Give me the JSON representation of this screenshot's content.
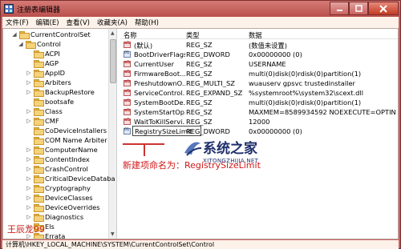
{
  "window": {
    "title": "注册表编辑器",
    "app_icon": "regedit-icon",
    "controls": {
      "minimize": "minimize-icon",
      "maximize": "maximize-icon",
      "close": "close-icon"
    }
  },
  "menu": [
    "文件(F)",
    "编辑(E)",
    "查看(V)",
    "收藏夹(A)",
    "帮助(H)"
  ],
  "tree": {
    "items": [
      {
        "label": "CurrentControlSet",
        "toggle": "◢",
        "level": 0
      },
      {
        "label": "Control",
        "toggle": "◢",
        "level": 1
      },
      {
        "label": "ACPI",
        "toggle": "",
        "level": 2
      },
      {
        "label": "AGP",
        "toggle": "",
        "level": 2
      },
      {
        "label": "AppID",
        "toggle": "▷",
        "level": 2
      },
      {
        "label": "Arbiters",
        "toggle": "▷",
        "level": 2
      },
      {
        "label": "BackupRestore",
        "toggle": "▷",
        "level": 2
      },
      {
        "label": "bootsafe",
        "toggle": "",
        "level": 2
      },
      {
        "label": "Class",
        "toggle": "▷",
        "level": 2
      },
      {
        "label": "CMF",
        "toggle": "▷",
        "level": 2
      },
      {
        "label": "CoDeviceInstallers",
        "toggle": "",
        "level": 2
      },
      {
        "label": "COM Name Arbiter",
        "toggle": "",
        "level": 2
      },
      {
        "label": "ComputerName",
        "toggle": "▷",
        "level": 2
      },
      {
        "label": "ContentIndex",
        "toggle": "▷",
        "level": 2
      },
      {
        "label": "CrashControl",
        "toggle": "▷",
        "level": 2
      },
      {
        "label": "CriticalDeviceDataba",
        "toggle": "▷",
        "level": 2
      },
      {
        "label": "Cryptography",
        "toggle": "▷",
        "level": 2
      },
      {
        "label": "DeviceClasses",
        "toggle": "▷",
        "level": 2
      },
      {
        "label": "DeviceOverrides",
        "toggle": "▷",
        "level": 2
      },
      {
        "label": "Diagnostics",
        "toggle": "▷",
        "level": 2
      },
      {
        "label": "Els",
        "toggle": "▷",
        "level": 2
      },
      {
        "label": "Errata",
        "toggle": "▷",
        "level": 2
      }
    ]
  },
  "list": {
    "columns": [
      "名称",
      "类型",
      "数据"
    ],
    "rows": [
      {
        "name": "(默认)",
        "type": "REG_SZ",
        "data": "(数值未设置)",
        "kind": "str"
      },
      {
        "name": "BootDriverFlags",
        "type": "REG_DWORD",
        "data": "0x00000000 (0)",
        "kind": "bin"
      },
      {
        "name": "CurrentUser",
        "type": "REG_SZ",
        "data": "USERNAME",
        "kind": "str"
      },
      {
        "name": "FirmwareBoot...",
        "type": "REG_SZ",
        "data": "multi(0)disk(0)rdisk(0)partition(1)",
        "kind": "str"
      },
      {
        "name": "PreshutdownO...",
        "type": "REG_MULTI_SZ",
        "data": "wuauserv gpsvc trustedinstaller",
        "kind": "str"
      },
      {
        "name": "ServiceControl...",
        "type": "REG_EXPAND_SZ",
        "data": "%systemroot%\\system32\\scext.dll",
        "kind": "str"
      },
      {
        "name": "SystemBootDe...",
        "type": "REG_SZ",
        "data": "multi(0)disk(0)rdisk(0)partition(1)",
        "kind": "str"
      },
      {
        "name": "SystemStartOp...",
        "type": "REG_SZ",
        "data": " MAXMEM=8589934592  NOEXECUTE=OPTIN ...",
        "kind": "str"
      },
      {
        "name": "WaitToKillServi...",
        "type": "REG_SZ",
        "data": "12000",
        "kind": "str"
      },
      {
        "name": "RegistrySizeLimit",
        "type": "REG_DWORD",
        "data": "0x00000000 (0)",
        "kind": "bin",
        "editing": true
      }
    ]
  },
  "annotation": "新建项命名为：RegistrySizeLimit",
  "status": "计算机\\HKEY_LOCAL_MACHINE\\SYSTEM\\CurrentControlSet\\Control",
  "watermarks": {
    "author": "王辰龙99",
    "site_cn": "系统之家",
    "site_en": "XITONGZHIJIA.NET"
  },
  "colors": {
    "frame": "#c9615f",
    "annotation": "#d01818",
    "logo": "#1f2f6b"
  }
}
